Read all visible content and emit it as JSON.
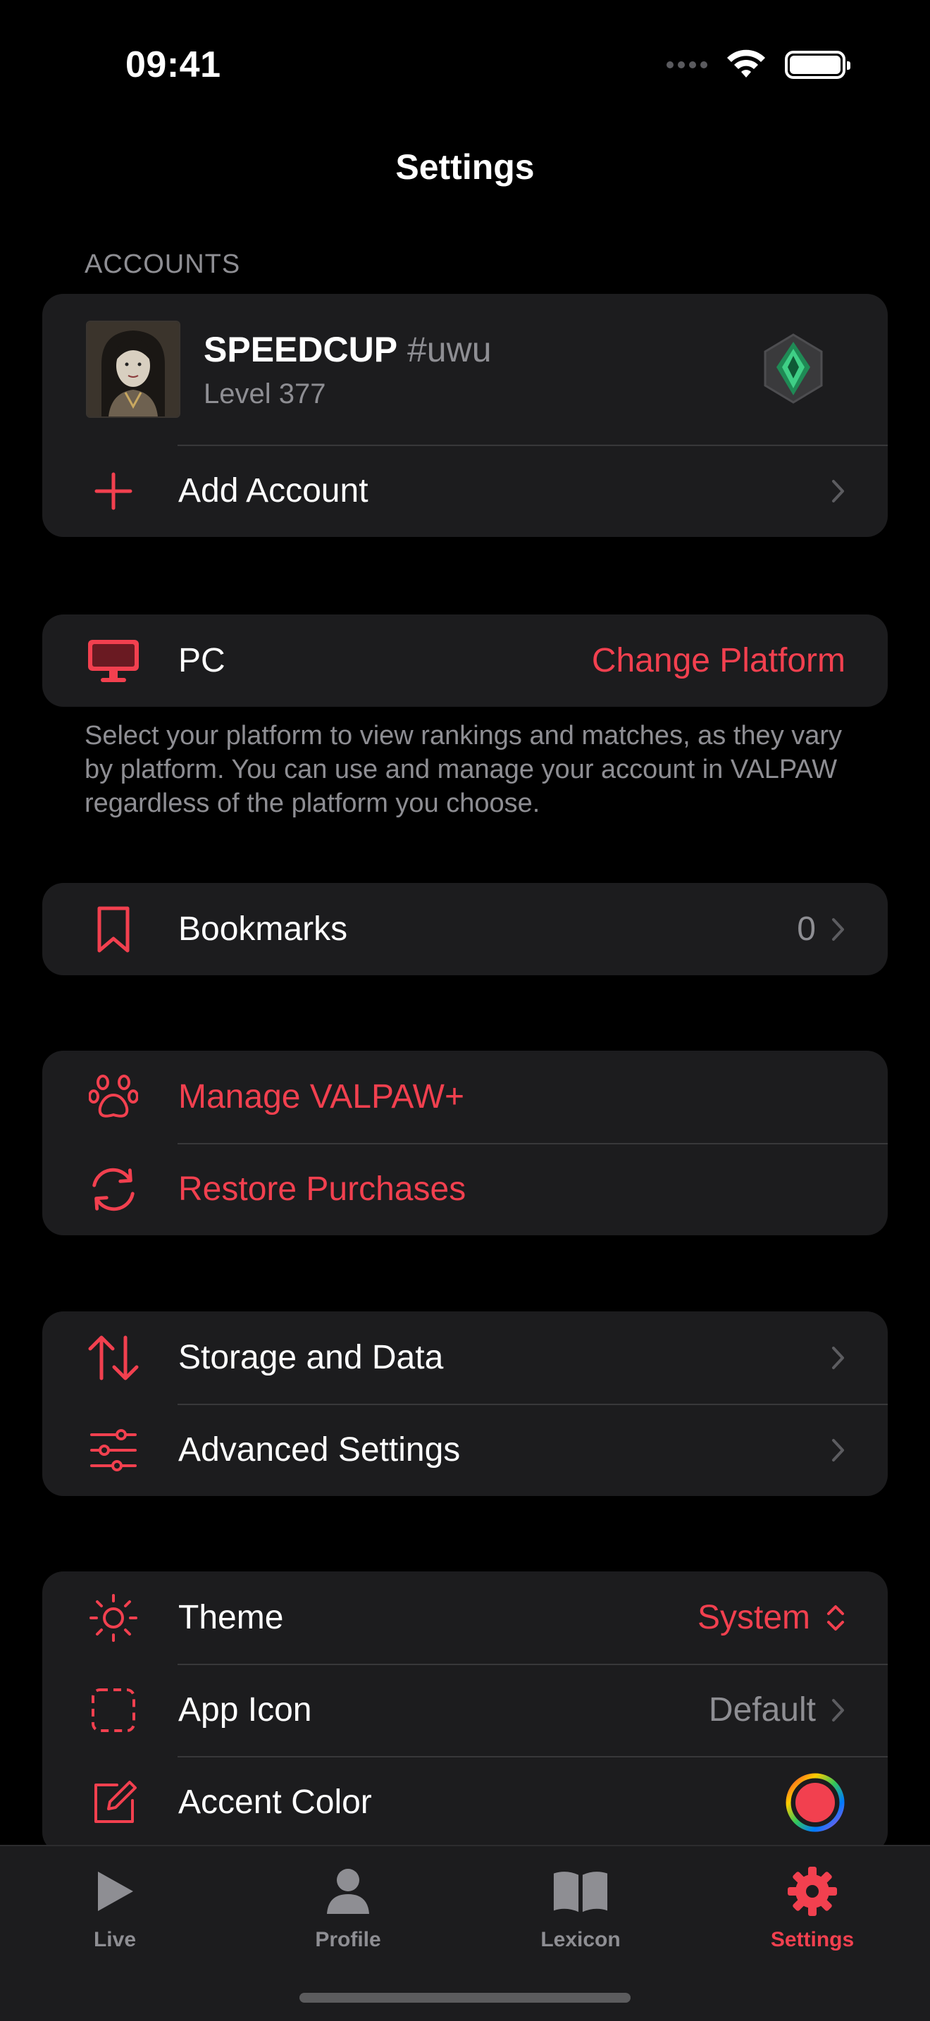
{
  "status_bar": {
    "time": "09:41"
  },
  "nav": {
    "title": "Settings"
  },
  "accounts": {
    "header": "ACCOUNTS",
    "account": {
      "name": "SPEEDCUP",
      "tag": "#uwu",
      "level": "Level 377"
    },
    "add_account_label": "Add Account"
  },
  "platform": {
    "label": "PC",
    "change_label": "Change Platform",
    "footer": "Select your platform to view rankings and matches, as they vary by platform. You can use and manage your account in VALPAW regardless of the platform you choose."
  },
  "bookmarks": {
    "label": "Bookmarks",
    "count": "0"
  },
  "purchases": {
    "manage_label": "Manage VALPAW+",
    "restore_label": "Restore Purchases"
  },
  "data_settings": {
    "storage_label": "Storage and Data",
    "advanced_label": "Advanced Settings"
  },
  "appearance": {
    "theme_label": "Theme",
    "theme_value": "System",
    "app_icon_label": "App Icon",
    "app_icon_value": "Default",
    "accent_label": "Accent Color"
  },
  "tabbar": {
    "tabs": [
      {
        "label": "Live",
        "icon": "play-icon"
      },
      {
        "label": "Profile",
        "icon": "person-icon"
      },
      {
        "label": "Lexicon",
        "icon": "book-icon"
      },
      {
        "label": "Settings",
        "icon": "gear-icon"
      }
    ],
    "active": "Settings"
  },
  "colors": {
    "accent": "#f2404f",
    "background": "#000000",
    "cell": "#1c1c1e",
    "secondary_text": "#8e8e93"
  }
}
